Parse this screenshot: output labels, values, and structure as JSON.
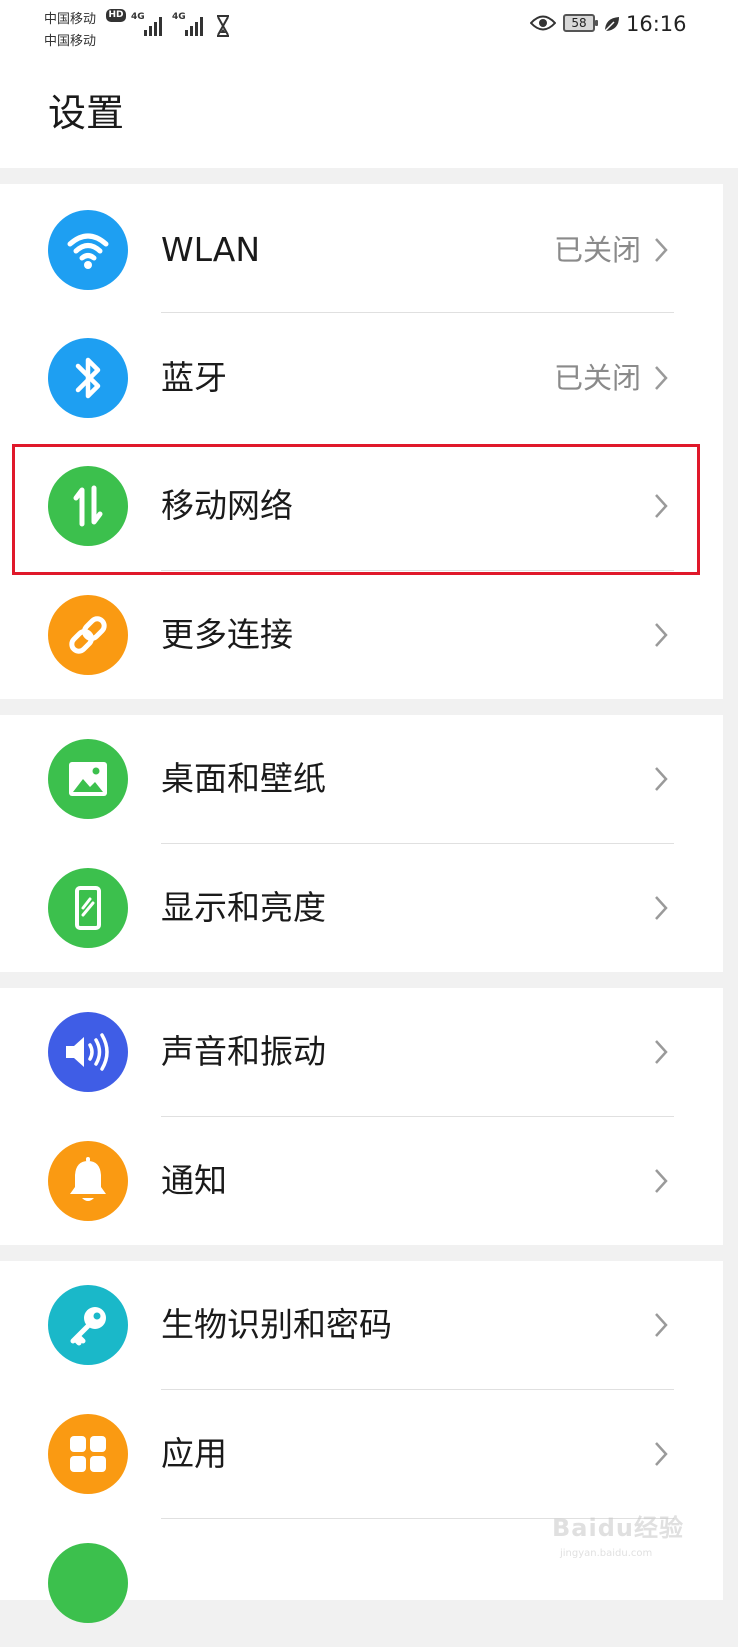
{
  "status_bar": {
    "carrier_1": "中国移动",
    "carrier_2": "中国移动",
    "hd_badge": "HD",
    "signal_1_label": "4G",
    "signal_2_label": "4G",
    "battery_level": "58",
    "time": "16:16"
  },
  "page": {
    "title": "设置"
  },
  "sections": [
    {
      "items": [
        {
          "label": "WLAN",
          "status": "已关闭",
          "icon": "wifi-icon",
          "color": "#1e9ff2"
        },
        {
          "label": "蓝牙",
          "status": "已关闭",
          "icon": "bluetooth-icon",
          "color": "#1e9ff2"
        },
        {
          "label": "移动网络",
          "status": "",
          "icon": "mobile-data-icon",
          "color": "#3cc04d"
        },
        {
          "label": "更多连接",
          "status": "",
          "icon": "link-icon",
          "color": "#fa9a12"
        }
      ]
    },
    {
      "items": [
        {
          "label": "桌面和壁纸",
          "status": "",
          "icon": "wallpaper-icon",
          "color": "#3cc04d"
        },
        {
          "label": "显示和亮度",
          "status": "",
          "icon": "display-icon",
          "color": "#3cc04d"
        }
      ]
    },
    {
      "items": [
        {
          "label": "声音和振动",
          "status": "",
          "icon": "sound-icon",
          "color": "#3f5de6"
        },
        {
          "label": "通知",
          "status": "",
          "icon": "bell-icon",
          "color": "#fa9a12"
        }
      ]
    },
    {
      "items": [
        {
          "label": "生物识别和密码",
          "status": "",
          "icon": "key-icon",
          "color": "#1ab8c9"
        },
        {
          "label": "应用",
          "status": "",
          "icon": "apps-icon",
          "color": "#fa9a12"
        },
        {
          "label": "",
          "status": "",
          "icon": "partial-item-icon",
          "color": "#3cc04d"
        }
      ]
    }
  ],
  "annotation": {
    "highlight_color": "#e0182a"
  },
  "watermark": {
    "text": "Baidu经验",
    "sub": "jingyan.baidu.com"
  }
}
